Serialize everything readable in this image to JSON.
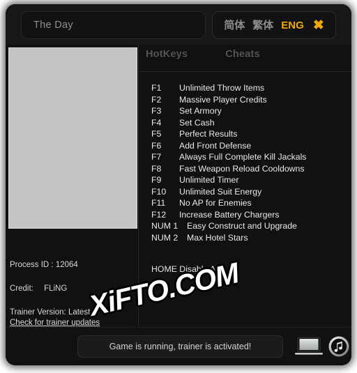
{
  "window": {
    "title": "The Day"
  },
  "languages": [
    {
      "label": "简体",
      "active": false,
      "name": "lang-simplified-chinese"
    },
    {
      "label": "繁体",
      "active": false,
      "name": "lang-traditional-chinese"
    },
    {
      "label": "ENG",
      "active": true,
      "name": "lang-english"
    }
  ],
  "close_label": "✖",
  "tabs": [
    {
      "label": "HotKeys",
      "active": true
    },
    {
      "label": "Cheats",
      "active": false
    }
  ],
  "cheats": [
    {
      "key": "F1",
      "label": "Unlimited Throw Items"
    },
    {
      "key": "F2",
      "label": "Massive Player Credits"
    },
    {
      "key": "F3",
      "label": "Set Armory"
    },
    {
      "key": "F4",
      "label": "Set Cash"
    },
    {
      "key": "F5",
      "label": "Perfect Results"
    },
    {
      "key": "F6",
      "label": "Add Front Defense"
    },
    {
      "key": "F7",
      "label": "Always Full Complete Kill Jackals"
    },
    {
      "key": "F8",
      "label": "Fast Weapon Reload Cooldowns"
    },
    {
      "key": "F9",
      "label": "Unlimited Timer"
    },
    {
      "key": "F10",
      "label": "Unlimited Suit Energy"
    },
    {
      "key": "F11",
      "label": "No AP for Enemies"
    },
    {
      "key": "F12",
      "label": "Increase Battery Chargers"
    },
    {
      "key": "NUM 1",
      "label": "Easy Construct and Upgrade"
    },
    {
      "key": "NUM 2",
      "label": "Max Hotel Stars"
    }
  ],
  "disable_all": "HOME Disable All",
  "info": {
    "process_id": "Process ID : 12064",
    "credit_label": "Credit:",
    "credit_value": "FLiNG",
    "trainer_version": "Trainer Version: Latest",
    "update_link": "Check for trainer updates"
  },
  "status": {
    "message": "Game is running, trainer is activated!"
  },
  "watermark": "XiFTO.COM",
  "colors": {
    "accent": "#f0a80c",
    "window_bg": "#111111",
    "topbar_bg": "#171717",
    "text": "#e9e9e9",
    "muted": "#565656",
    "art_panel": "#c4c4c4"
  }
}
